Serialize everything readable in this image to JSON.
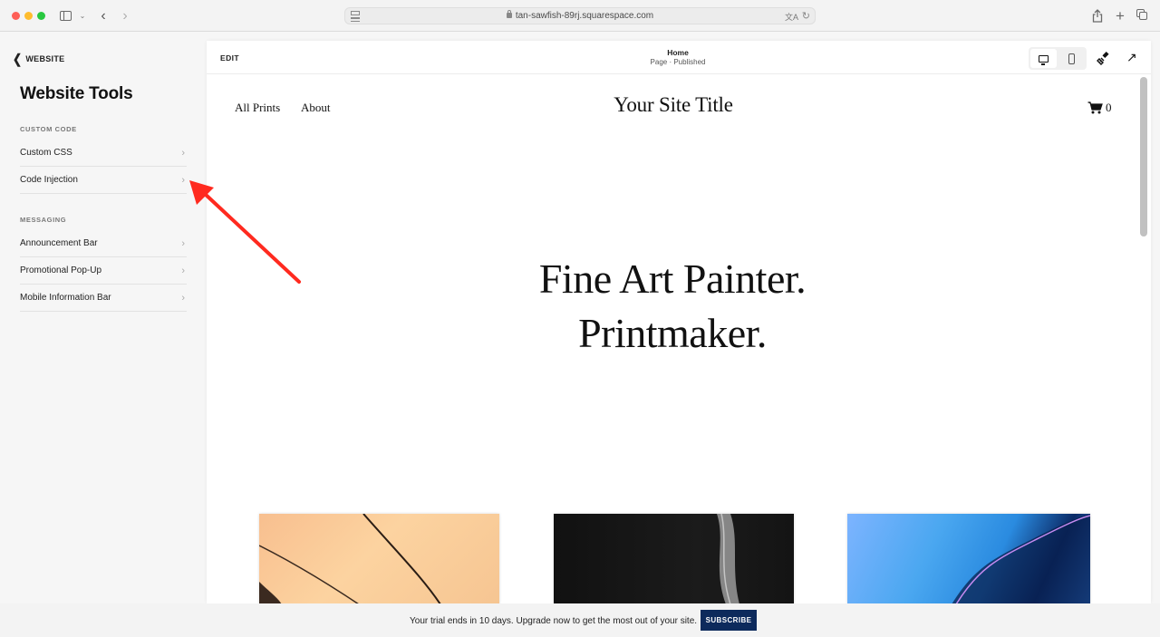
{
  "browser": {
    "url": "tan-sawfish-89rj.squarespace.com",
    "icons": {
      "sidebar": "sidebar-icon",
      "back": "chevron-left-icon",
      "forward": "chevron-right-icon",
      "share": "share-icon",
      "new_tab": "plus-icon",
      "tab_overview": "tabs-icon"
    }
  },
  "panel": {
    "back_label": "WEBSITE",
    "title": "Website Tools",
    "sections": [
      {
        "label": "CUSTOM CODE",
        "items": [
          {
            "label": "Custom CSS"
          },
          {
            "label": "Code Injection"
          }
        ]
      },
      {
        "label": "MESSAGING",
        "items": [
          {
            "label": "Announcement Bar"
          },
          {
            "label": "Promotional Pop-Up"
          },
          {
            "label": "Mobile Information Bar"
          }
        ]
      }
    ]
  },
  "editor": {
    "edit_label": "EDIT",
    "page_name": "Home",
    "page_status": "Page · Published",
    "device_modes": [
      "desktop",
      "mobile"
    ],
    "active_device": "desktop"
  },
  "site": {
    "nav": [
      "All Prints",
      "About"
    ],
    "title": "Your Site Title",
    "cart_count": "0",
    "hero_line1": "Fine Art Painter.",
    "hero_line2": "Printmaker."
  },
  "banner": {
    "text": "Your trial ends in 10 days. Upgrade now to get the most out of your site.",
    "button_label": "SUBSCRIBE",
    "button_color": "#0d2a5c"
  },
  "annotation": {
    "color": "#ff2a1f",
    "points_to": "Code Injection"
  }
}
